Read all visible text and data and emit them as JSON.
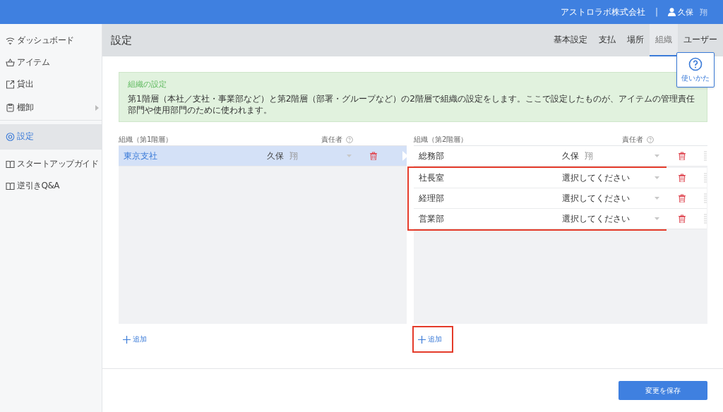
{
  "top_bar": {
    "company": "アストロラボ株式会社",
    "separator": "|",
    "user": {
      "family": "久保",
      "given": "翔"
    }
  },
  "sidebar": {
    "items": [
      {
        "label": "ダッシュボード",
        "selected": false,
        "has_submenu": false,
        "divider_after": false
      },
      {
        "label": "アイテム",
        "selected": false,
        "has_submenu": false,
        "divider_after": false
      },
      {
        "label": "貸出",
        "selected": false,
        "has_submenu": false,
        "divider_after": false
      },
      {
        "label": "棚卸",
        "selected": false,
        "has_submenu": true,
        "divider_after": true
      },
      {
        "label": "設定",
        "selected": true,
        "has_submenu": false,
        "divider_after": true
      },
      {
        "label": "スタートアップガイド",
        "selected": false,
        "has_submenu": false,
        "divider_after": false
      },
      {
        "label": "逆引きQ&A",
        "selected": false,
        "has_submenu": false,
        "divider_after": false
      }
    ]
  },
  "header": {
    "title": "設定",
    "tabs": [
      {
        "label": "基本設定",
        "selected": false
      },
      {
        "label": "支払",
        "selected": false
      },
      {
        "label": "場所",
        "selected": false
      },
      {
        "label": "組織",
        "selected": true
      },
      {
        "label": "ユーザー",
        "selected": false
      }
    ]
  },
  "help_popup": {
    "label": "使いかた"
  },
  "info_box": {
    "title": "組織の設定",
    "text": "第1階層（本社／支社・事業部など）と第2階層（部署・グループなど）の2階層で組織の設定をします。ここで設定したものが、アイテムの管理責任部門や使用部門のために使われます。"
  },
  "level1": {
    "column_name": "組織（第1階層）",
    "column_owner": "責任者",
    "add_label": "追加",
    "add_highlighted": false,
    "rows": [
      {
        "name": "東京支社",
        "owner": {
          "family": "久保",
          "given": "翔"
        },
        "selected": true,
        "highlighted": false
      }
    ]
  },
  "level2": {
    "column_name": "組織（第2階層）",
    "column_owner": "責任者",
    "add_label": "追加",
    "add_highlighted": true,
    "rows": [
      {
        "name": "総務部",
        "owner": {
          "family": "久保",
          "given": "翔"
        },
        "selected": false,
        "highlighted": false
      },
      {
        "name": "社長室",
        "placeholder": "選択してください",
        "selected": false,
        "highlighted": true
      },
      {
        "name": "経理部",
        "placeholder": "選択してください",
        "selected": false,
        "highlighted": true
      },
      {
        "name": "営業部",
        "placeholder": "選択してください",
        "selected": false,
        "highlighted": true
      }
    ]
  },
  "save_button": "変更を保存"
}
